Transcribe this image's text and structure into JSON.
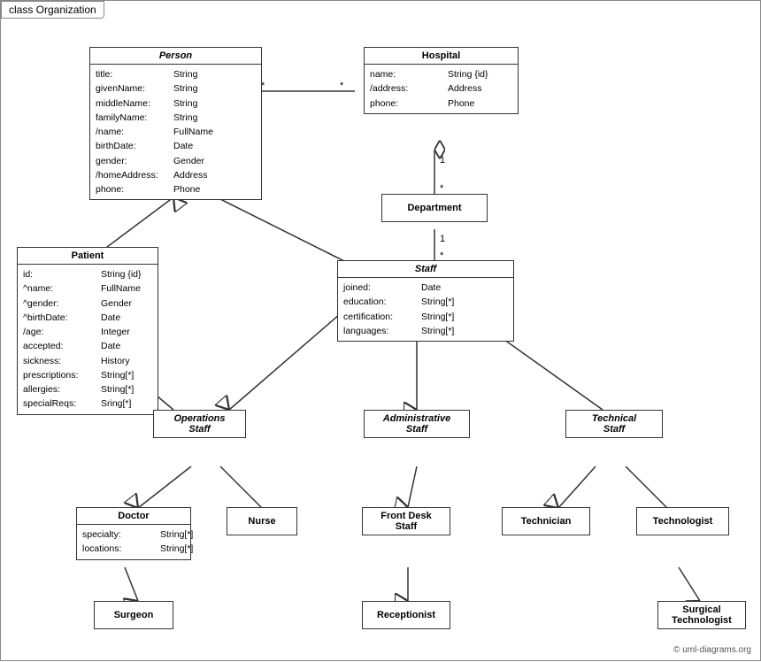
{
  "title": "class Organization",
  "copyright": "© uml-diagrams.org",
  "classes": {
    "person": {
      "name": "Person",
      "attrs": [
        [
          "title:",
          "String"
        ],
        [
          "givenName:",
          "String"
        ],
        [
          "middleName:",
          "String"
        ],
        [
          "familyName:",
          "String"
        ],
        [
          "/name:",
          "FullName"
        ],
        [
          "birthDate:",
          "Date"
        ],
        [
          "gender:",
          "Gender"
        ],
        [
          "/homeAddress:",
          "Address"
        ],
        [
          "phone:",
          "Phone"
        ]
      ]
    },
    "hospital": {
      "name": "Hospital",
      "attrs": [
        [
          "name:",
          "String {id}"
        ],
        [
          "/address:",
          "Address"
        ],
        [
          "phone:",
          "Phone"
        ]
      ]
    },
    "patient": {
      "name": "Patient",
      "attrs": [
        [
          "id:",
          "String {id}"
        ],
        [
          "^name:",
          "FullName"
        ],
        [
          "^gender:",
          "Gender"
        ],
        [
          "^birthDate:",
          "Date"
        ],
        [
          "/age:",
          "Integer"
        ],
        [
          "accepted:",
          "Date"
        ],
        [
          "sickness:",
          "History"
        ],
        [
          "prescriptions:",
          "String[*]"
        ],
        [
          "allergies:",
          "String[*]"
        ],
        [
          "specialReqs:",
          "Sring[*]"
        ]
      ]
    },
    "department": {
      "name": "Department"
    },
    "staff": {
      "name": "Staff",
      "attrs": [
        [
          "joined:",
          "Date"
        ],
        [
          "education:",
          "String[*]"
        ],
        [
          "certification:",
          "String[*]"
        ],
        [
          "languages:",
          "String[*]"
        ]
      ]
    },
    "operations_staff": {
      "name": "Operations\nStaff"
    },
    "administrative_staff": {
      "name": "Administrative\nStaff"
    },
    "technical_staff": {
      "name": "Technical\nStaff"
    },
    "doctor": {
      "name": "Doctor",
      "attrs": [
        [
          "specialty:",
          "String[*]"
        ],
        [
          "locations:",
          "String[*]"
        ]
      ]
    },
    "nurse": {
      "name": "Nurse"
    },
    "front_desk_staff": {
      "name": "Front Desk\nStaff"
    },
    "technician": {
      "name": "Technician"
    },
    "technologist": {
      "name": "Technologist"
    },
    "surgeon": {
      "name": "Surgeon"
    },
    "receptionist": {
      "name": "Receptionist"
    },
    "surgical_technologist": {
      "name": "Surgical\nTechnologist"
    }
  }
}
